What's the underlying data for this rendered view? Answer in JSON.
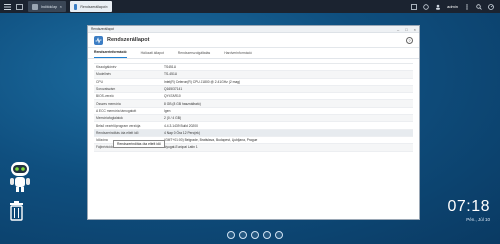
{
  "topbar": {
    "tasks": [
      {
        "label": "Indítóközp"
      },
      {
        "label": "Rendszerállapot"
      }
    ],
    "user": "admin"
  },
  "window": {
    "title": "Rendszerállapot",
    "app_title": "Rendszerállapot",
    "help": "?",
    "tabs": [
      "Rendszerinformáció",
      "Hálózati állapot",
      "Rendszerszolgáltatás",
      "Hardverinformáció"
    ],
    "rows": [
      {
        "k": "Kiszolgálónév",
        "v": "TS451U"
      },
      {
        "k": "Modellnév",
        "v": "TS-451U"
      },
      {
        "k": "CPU",
        "v": "Intel(R) Celeron(R) CPU J1800 @ 2.41GHz (2 mag)"
      },
      {
        "k": "Sorozatszám",
        "v": "Q165I37141"
      },
      {
        "k": "BIOS-verzió",
        "v": "QY47AR10"
      },
      {
        "k": "Összes memória",
        "v": "8 GB (8 GB használható)"
      },
      {
        "k": "A ECC memória támogatott",
        "v": "Igen"
      },
      {
        "k": "Memóriafoglalatok",
        "v": "2 (0 / 4 GB)"
      },
      {
        "k": "Belső vezérlőprogram verziója",
        "v": "4.4.3.1439 Build 20200"
      },
      {
        "k": "Rendszerindítás óta eltelt idő",
        "v": "4 Nap 0 Óra 12 Perc(ek)"
      },
      {
        "k": "Időzóna",
        "v": "(GMT+01:00) Belgrade, Bratislava, Budapest, Ljubljana, Prague"
      },
      {
        "k": "Fájlnévkódolás",
        "v": "Nyugat-Európai Latin 1"
      }
    ],
    "tooltip": "Rendszerindítás óta eltelt idő"
  },
  "clock": {
    "time": "07:18",
    "date": "Pén., Júl 10"
  }
}
